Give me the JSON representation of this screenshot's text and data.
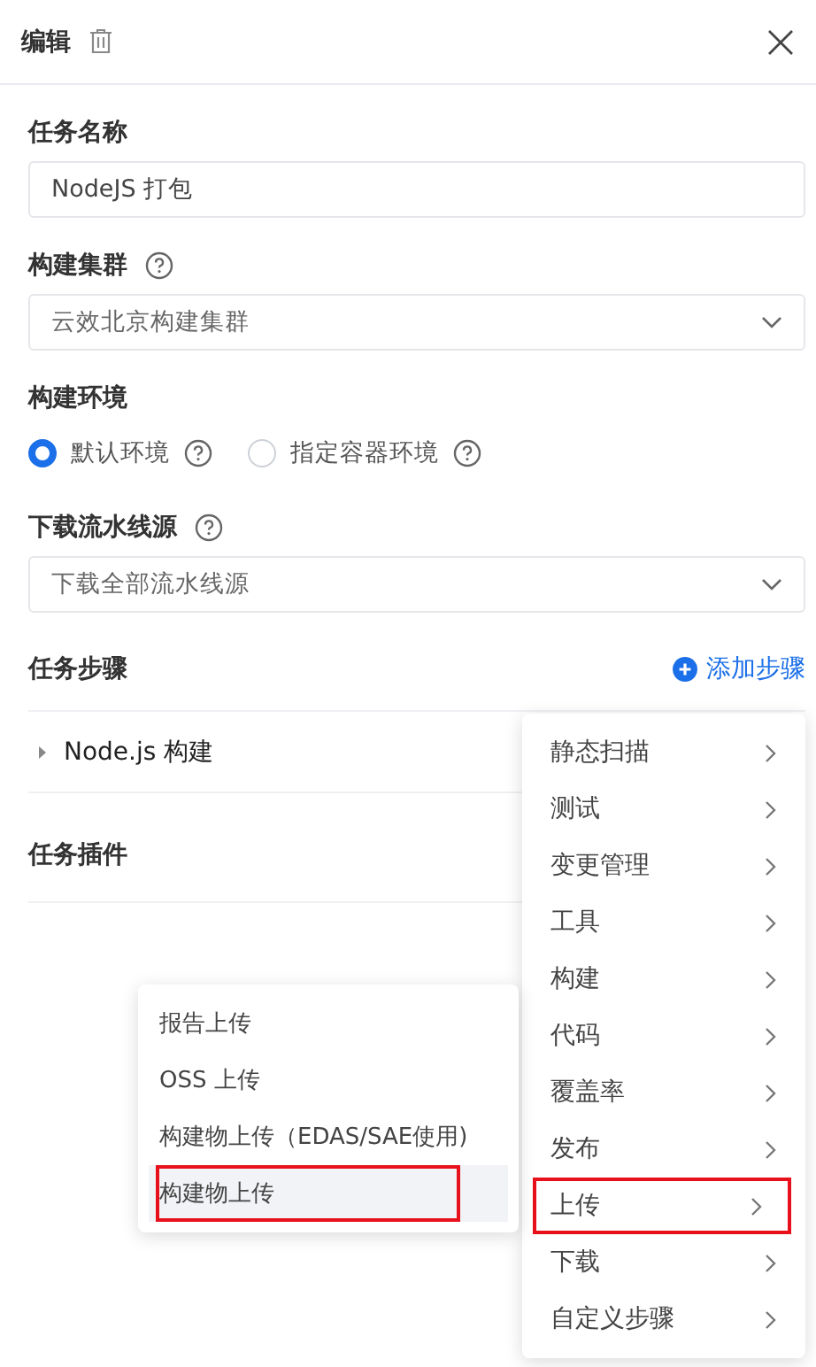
{
  "header": {
    "title": "编辑"
  },
  "fields": [
    {
      "kind": "input",
      "label": "任务名称",
      "help": false,
      "value": "NodeJS 打包"
    },
    {
      "kind": "select",
      "label": "构建集群",
      "help": true,
      "value": "云效北京构建集群"
    },
    {
      "kind": "radio",
      "label": "构建环境",
      "help": false,
      "options": [
        {
          "label": "默认环境",
          "selected": true
        },
        {
          "label": "指定容器环境",
          "selected": false
        }
      ]
    },
    {
      "kind": "select",
      "label": "下载流水线源",
      "help": true,
      "value": "下载全部流水线源"
    }
  ],
  "steps": {
    "title": "任务步骤",
    "add_label": "添加步骤",
    "items": [
      {
        "label": "Node.js 构建",
        "expanded": false
      }
    ]
  },
  "plugins": {
    "title": "任务插件"
  },
  "step_menu": [
    {
      "label": "静态扫描",
      "selected": false,
      "annotated": false
    },
    {
      "label": "测试",
      "selected": false,
      "annotated": false
    },
    {
      "label": "变更管理",
      "selected": false,
      "annotated": false
    },
    {
      "label": "工具",
      "selected": false,
      "annotated": false
    },
    {
      "label": "构建",
      "selected": false,
      "annotated": false
    },
    {
      "label": "代码",
      "selected": false,
      "annotated": false
    },
    {
      "label": "覆盖率",
      "selected": false,
      "annotated": false
    },
    {
      "label": "发布",
      "selected": false,
      "annotated": false
    },
    {
      "label": "上传",
      "selected": false,
      "annotated": true
    },
    {
      "label": "下载",
      "selected": false,
      "annotated": false
    },
    {
      "label": "自定义步骤",
      "selected": false,
      "annotated": false
    }
  ],
  "submenu": [
    {
      "label": "报告上传",
      "selected": false,
      "annotated": false
    },
    {
      "label": "OSS 上传",
      "selected": false,
      "annotated": false
    },
    {
      "label": "构建物上传（EDAS/SAE使用)",
      "selected": false,
      "annotated": false
    },
    {
      "label": "构建物上传",
      "selected": true,
      "annotated": true
    }
  ]
}
